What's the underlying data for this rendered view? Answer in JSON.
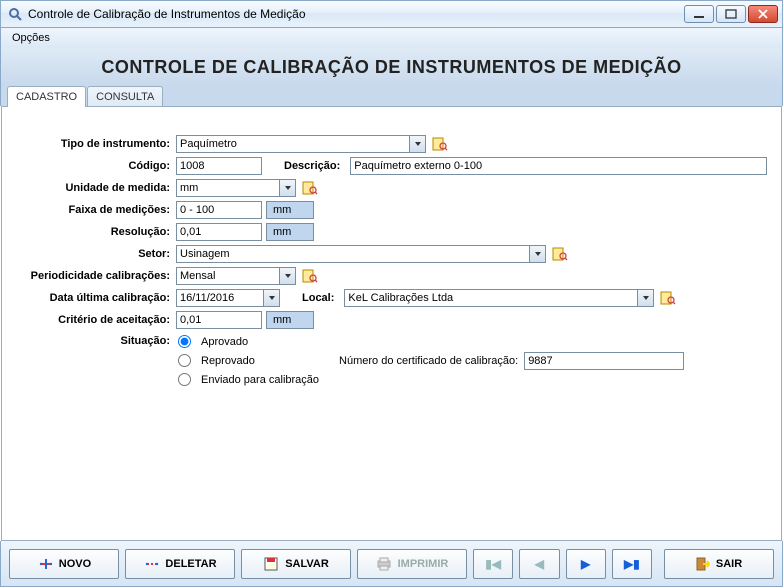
{
  "window": {
    "title": "Controle de Calibração de Instrumentos de Medição"
  },
  "menu": {
    "opcoes": "Opções"
  },
  "header": "CONTROLE DE CALIBRAÇÃO DE INSTRUMENTOS DE MEDIÇÃO",
  "tabs": {
    "cadastro": "CADASTRO",
    "consulta": "CONSULTA"
  },
  "labels": {
    "tipo_instrumento": "Tipo de instrumento:",
    "codigo": "Código:",
    "descricao": "Descrição:",
    "unidade_medida": "Unidade de medida:",
    "faixa_medicoes": "Faixa de medições:",
    "resolucao": "Resolução:",
    "setor": "Setor:",
    "periodicidade": "Periodicidade calibrações:",
    "data_ultima": "Data última calibração:",
    "local": "Local:",
    "criterio": "Critério de aceitação:",
    "situacao": "Situação:",
    "num_certificado": "Número do certificado de calibração:"
  },
  "values": {
    "tipo_instrumento": "Paquímetro",
    "codigo": "1008",
    "descricao": "Paquímetro externo 0-100",
    "unidade_medida": "mm",
    "faixa_medicoes": "0 - 100",
    "faixa_unit": "mm",
    "resolucao": "0,01",
    "resolucao_unit": "mm",
    "setor": "Usinagem",
    "periodicidade": "Mensal",
    "data_ultima": "16/11/2016",
    "local": "KeL Calibrações Ltda",
    "criterio": "0,01",
    "criterio_unit": "mm",
    "num_certificado": "9887"
  },
  "situacao_options": {
    "aprovado": "Aprovado",
    "reprovado": "Reprovado",
    "enviado": "Enviado para calibração",
    "selected": "aprovado"
  },
  "buttons": {
    "novo": "NOVO",
    "deletar": "DELETAR",
    "salvar": "SALVAR",
    "imprimir": "IMPRIMIR",
    "sair": "SAIR"
  }
}
